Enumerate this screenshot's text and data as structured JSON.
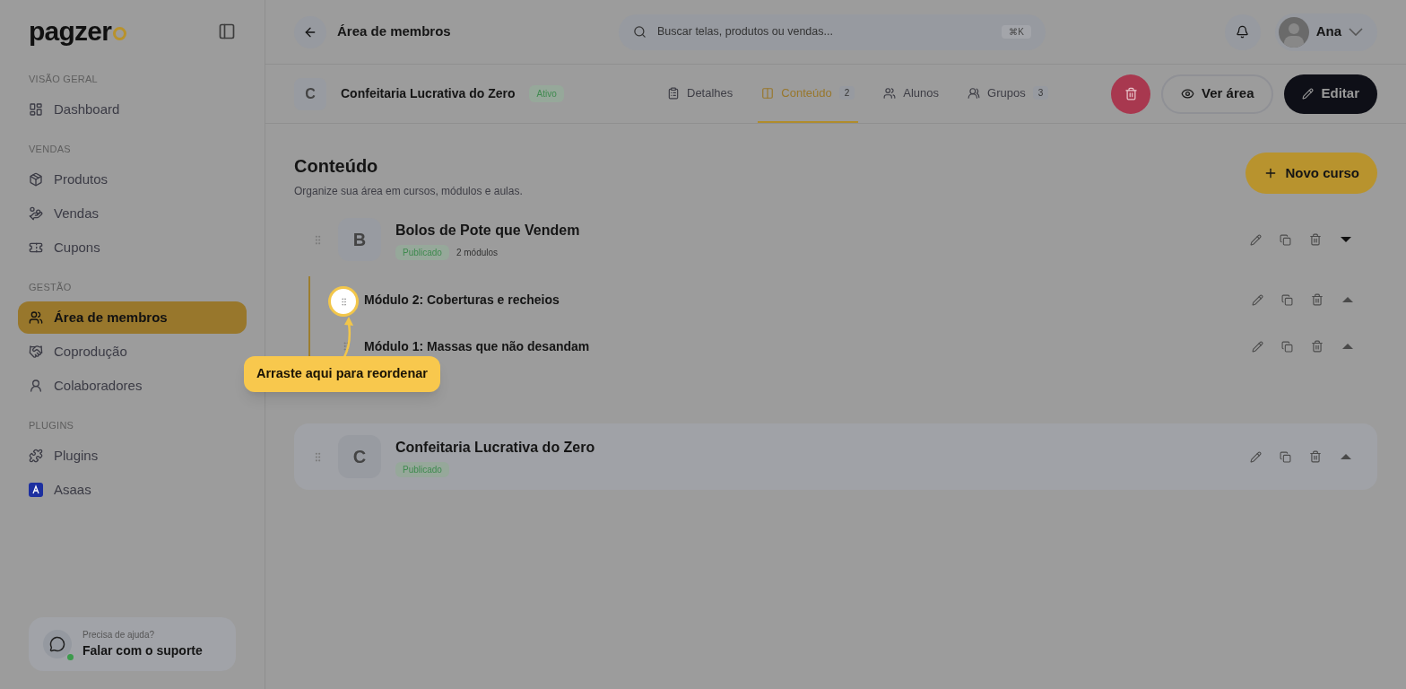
{
  "sidebar": {
    "logo": "pagzer",
    "sections": [
      {
        "title": "VISÃO GERAL",
        "items": [
          {
            "label": "Dashboard",
            "selected": false
          }
        ]
      },
      {
        "title": "VENDAS",
        "items": [
          {
            "label": "Produtos",
            "selected": false
          },
          {
            "label": "Vendas",
            "selected": false
          },
          {
            "label": "Cupons",
            "selected": false
          }
        ]
      },
      {
        "title": "GESTÃO",
        "items": [
          {
            "label": "Área de membros",
            "selected": true
          },
          {
            "label": "Coprodução",
            "selected": false
          },
          {
            "label": "Colaboradores",
            "selected": false
          }
        ]
      },
      {
        "title": "PLUGINS",
        "items": [
          {
            "label": "Plugins",
            "selected": false
          },
          {
            "label": "Asaas",
            "selected": false
          }
        ]
      }
    ],
    "help": {
      "caption": "Precisa de ajuda?",
      "link": "Falar com o suporte",
      "online": true
    }
  },
  "header": {
    "title": "Área de membros",
    "search": {
      "placeholder": "Buscar telas, produtos ou vendas...",
      "shortcut": "⌘K"
    },
    "user": {
      "name": "Ana"
    }
  },
  "area": {
    "initial": "C",
    "name": "Confeitaria Lucrativa do Zero",
    "status": "Ativo",
    "tabs": [
      {
        "label": "Detalhes",
        "selected": false
      },
      {
        "label": "Conteúdo",
        "count": "2",
        "selected": true
      },
      {
        "label": "Alunos",
        "selected": false
      },
      {
        "label": "Grupos",
        "count": "3",
        "selected": false
      }
    ],
    "actions": {
      "view": "Ver área",
      "edit": "Editar"
    }
  },
  "content": {
    "title": "Conteúdo",
    "subtitle": "Organize sua área em cursos, módulos e aulas.",
    "new_course": "Novo curso",
    "courses": [
      {
        "initial": "B",
        "title": "Bolos de Pote que Vendem",
        "status": "Publicado",
        "modules_count": "2 módulos",
        "expanded": true,
        "modules": [
          {
            "title": "Módulo 2: Coberturas e recheios",
            "expanded": false
          },
          {
            "title": "Módulo 1: Massas que não desandam",
            "expanded": false
          }
        ]
      },
      {
        "initial": "C",
        "title": "Confeitaria Lucrativa do Zero",
        "status": "Publicado",
        "expanded": false
      }
    ]
  },
  "tooltip": {
    "text": "Arraste aqui para reordenar"
  }
}
